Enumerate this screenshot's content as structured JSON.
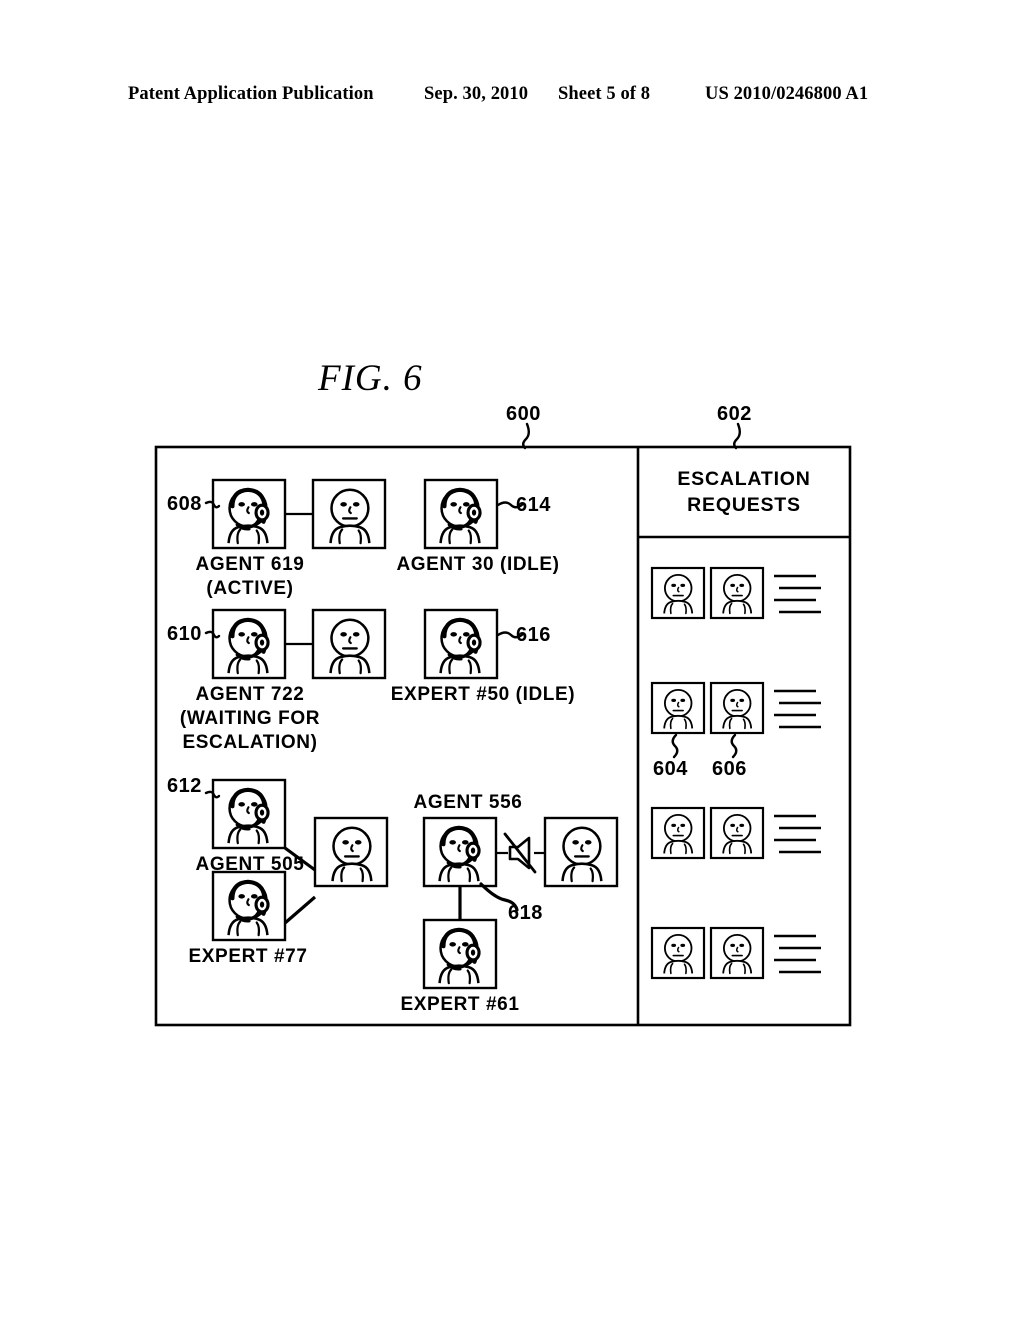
{
  "header": {
    "publication": "Patent Application Publication",
    "date": "Sep. 30, 2010",
    "sheet": "Sheet 5 of 8",
    "number": "US 2010/0246800 A1"
  },
  "figure": {
    "title": "FIG. 6",
    "refs": {
      "main_panel": "600",
      "escalation_panel": "602",
      "escalation_person_a": "604",
      "escalation_person_b": "606",
      "session_619": "608",
      "session_722": "610",
      "session_505": "612",
      "agent_30": "614",
      "expert_50": "616",
      "mute_indicator": "618"
    }
  },
  "main_panel": {
    "sessions": [
      {
        "ref": "608",
        "agent_label": "AGENT 619",
        "status_label": "(ACTIVE)",
        "agent_icon": "agent-headset-icon",
        "customer_icon": "customer-person-icon",
        "link": "active-call-line"
      },
      {
        "ref": "610",
        "agent_label": "AGENT 722",
        "status_label": "(WAITING FOR",
        "status_label_2": "ESCALATION)",
        "agent_icon": "agent-headset-icon",
        "customer_icon": "customer-person-icon",
        "link": "active-call-line"
      },
      {
        "ref": "612",
        "agent_label": "AGENT 505",
        "expert_label": "EXPERT #77",
        "agent_icon": "agent-headset-icon",
        "expert_icon": "expert-headset-icon",
        "customer_icon": "customer-person-icon",
        "link": "conference-call-lines"
      }
    ],
    "idle": [
      {
        "ref": "614",
        "label": "AGENT 30 (IDLE)",
        "icon": "agent-headset-icon"
      },
      {
        "ref": "616",
        "label": "EXPERT #50 (IDLE)",
        "icon": "expert-headset-icon"
      }
    ],
    "muted_session": {
      "agent_label": "AGENT 556",
      "expert_label": "EXPERT #61",
      "mute_ref": "618",
      "agent_icon": "agent-headset-icon",
      "expert_icon": "expert-headset-icon",
      "customer_icon": "customer-person-icon",
      "mute_icon": "speaker-muted-icon"
    }
  },
  "escalation_panel": {
    "title_line_1": "ESCALATION",
    "title_line_2": "REQUESTS",
    "rows": [
      {
        "icon_a": "customer-person-icon",
        "icon_b": "customer-person-icon",
        "detail_lines": 4
      },
      {
        "icon_a": "customer-person-icon",
        "icon_b": "customer-person-icon",
        "detail_lines": 4,
        "ref_a": "604",
        "ref_b": "606"
      },
      {
        "icon_a": "customer-person-icon",
        "icon_b": "customer-person-icon",
        "detail_lines": 4
      },
      {
        "icon_a": "customer-person-icon",
        "icon_b": "customer-person-icon",
        "detail_lines": 4
      }
    ]
  },
  "colors": {
    "ink": "#000000",
    "paper": "#ffffff"
  }
}
